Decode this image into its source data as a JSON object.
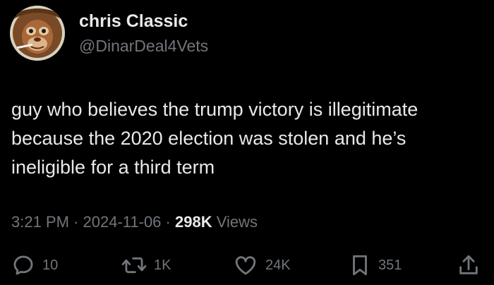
{
  "author": {
    "display_name": "chris Classic",
    "handle": "@DinarDeal4Vets"
  },
  "tweet": {
    "text": "guy who believes the trump victory is illegitimate\nbecause the 2020 election was stolen and he’s\nineligible for a third term"
  },
  "meta": {
    "time": "3:21 PM",
    "separator": "·",
    "date": "2024-11-06",
    "views_count": "298K",
    "views_label": "Views"
  },
  "actions": {
    "replies": {
      "icon": "reply-icon",
      "count": "10"
    },
    "reposts": {
      "icon": "repost-icon",
      "count": "1K"
    },
    "likes": {
      "icon": "heart-icon",
      "count": "24K"
    },
    "bookmarks": {
      "icon": "bookmark-icon",
      "count": "351"
    },
    "share": {
      "icon": "share-icon"
    }
  },
  "colors": {
    "background": "#000000",
    "primary_text": "#e7e9ea",
    "secondary_text": "#71767b"
  }
}
